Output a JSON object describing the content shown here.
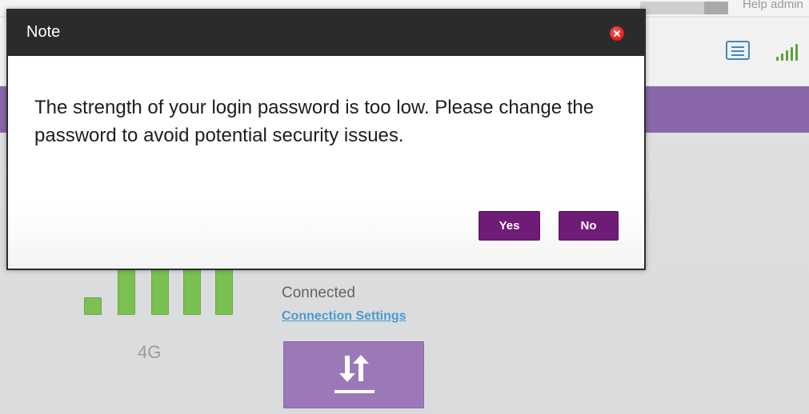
{
  "background": {
    "top_links": "Help  admin",
    "status": "Connected",
    "connection_link": "Connection Settings",
    "network_type": "4G",
    "signal_level": "5/5",
    "colors": {
      "nav": "#8a67a8",
      "signal": "#7cbf52",
      "link": "#4b9ad4",
      "button": "#9b78b8"
    },
    "icons": [
      "message-icon",
      "signal-icon",
      "transfer-icon"
    ]
  },
  "dialog": {
    "title": "Note",
    "message": "The strength of your login password is too low. Please change the password to avoid potential security issues.",
    "yes_label": "Yes",
    "no_label": "No",
    "close_icon": "close-icon",
    "colors": {
      "titlebar": "#2b2b2b",
      "button": "#6e1c75",
      "close": "#c90000"
    }
  }
}
